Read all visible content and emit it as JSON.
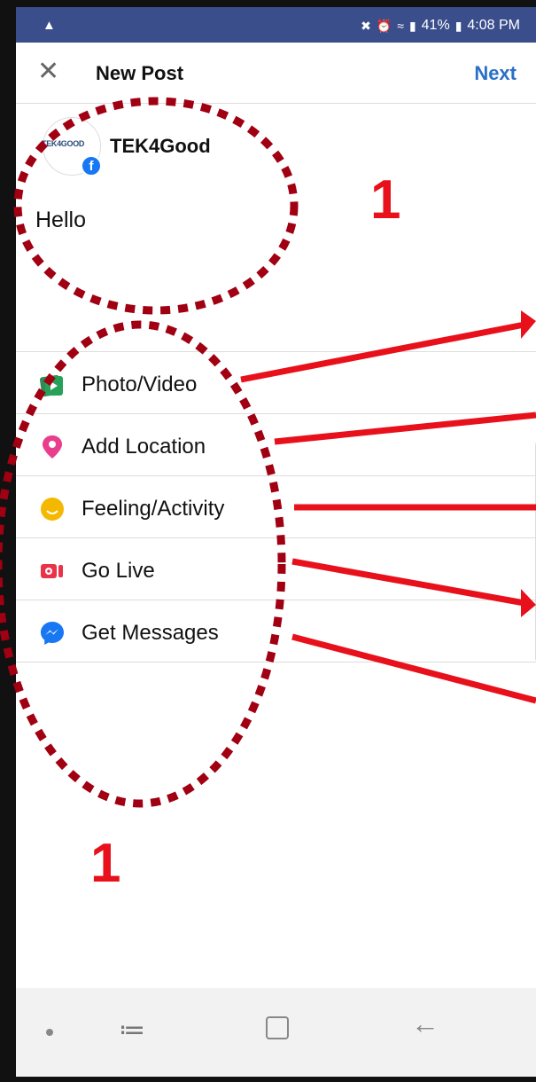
{
  "status_bar": {
    "battery": "41%",
    "time": "4:08 PM",
    "left_icon": "notification-icon"
  },
  "header": {
    "title": "New Post",
    "next_label": "Next",
    "close_icon": "close-icon"
  },
  "post": {
    "username": "TEK4Good",
    "avatar_text": "TEK4GOOD",
    "text": "Hello"
  },
  "menu": {
    "items": [
      {
        "label": "Photo/Video",
        "icon": "photo-video-icon",
        "color": "#2e8b57"
      },
      {
        "label": "Add Location",
        "icon": "location-pin-icon",
        "color": "#e83e8c"
      },
      {
        "label": "Feeling/Activity",
        "icon": "smiley-icon",
        "color": "#f5b800"
      },
      {
        "label": "Go Live",
        "icon": "live-video-icon",
        "color": "#e8334a"
      },
      {
        "label": "Get Messages",
        "icon": "messenger-icon",
        "color": "#1877f2"
      }
    ]
  },
  "annotations": {
    "label_top": "1",
    "label_bottom": "1",
    "color": "#e8101a",
    "dotted_color": "#a00012"
  }
}
